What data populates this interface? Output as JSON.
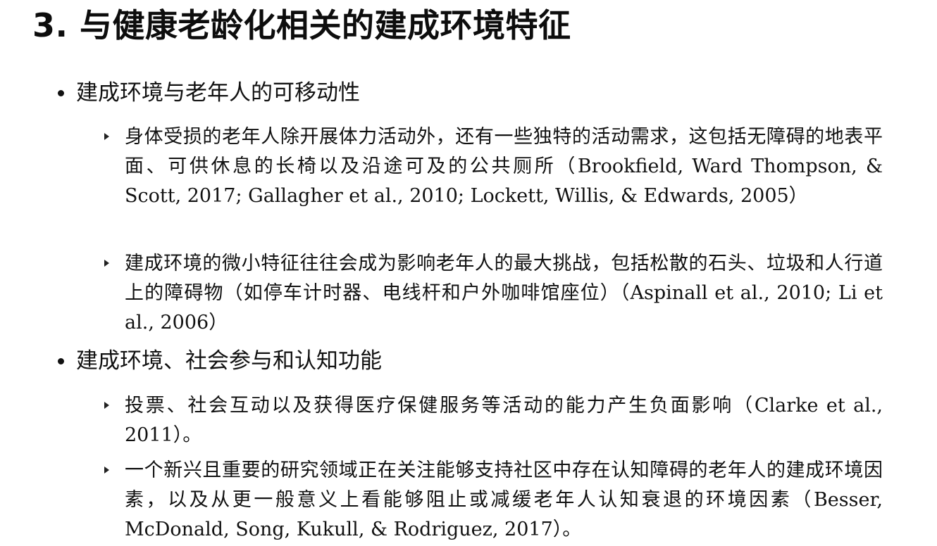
{
  "title": "3. 与健康老龄化相关的建成环境特征",
  "sections": [
    {
      "heading": "建成环境与老年人的可移动性",
      "points": [
        "身体受损的老年人除开展体力活动外，还有一些独特的活动需求，这包括无障碍的地表平面、可供休息的长椅以及沿途可及的公共厕所（Brookfield, Ward Thompson, & Scott, 2017; Gallagher et al., 2010;  Lockett,  Willis, & Edwards, 2005）",
        "建成环境的微小特征往往会成为影响老年人的最大挑战，包括松散的石头、垃圾和人行道上的障碍物（如停车计时器、电线杆和户外咖啡馆座位）（Aspinall et al., 2010; Li et al., 2006）"
      ]
    },
    {
      "heading": "建成环境、社会参与和认知功能",
      "points": [
        "投票、社会互动以及获得医疗保健服务等活动的能力产生负面影响（Clarke et al., 2011）。",
        "一个新兴且重要的研究领域正在关注能够支持社区中存在认知障碍的老年人的建成环境因素，以及从更一般意义上看能够阻止或减缓老年人认知衰退的环境因素（Besser, McDonald, Song, Kukull, & Rodriguez, 2017）。"
      ]
    }
  ]
}
